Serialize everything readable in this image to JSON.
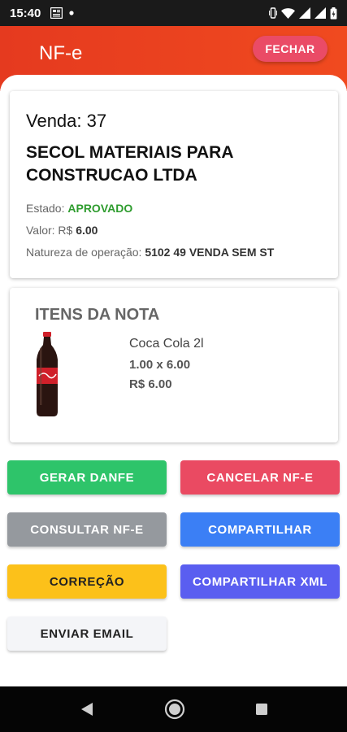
{
  "status_bar": {
    "time": "15:40"
  },
  "app_bar": {
    "title": "NF-e",
    "close_label": "FECHAR"
  },
  "sale": {
    "label": "Venda: 37",
    "company": "SECOL MATERIAIS PARA CONSTRUCAO LTDA",
    "state_label": "Estado:",
    "state_value": "APROVADO",
    "value_label": "Valor: R$",
    "value_value": "6.00",
    "nature_label": "Natureza de operação:",
    "nature_value": "5102 49 VENDA SEM ST"
  },
  "items": {
    "title": "ITENS DA NOTA",
    "list": [
      {
        "name": "Coca Cola 2l",
        "qty": "1.00 x 6.00",
        "total": "R$ 6.00"
      }
    ]
  },
  "actions": {
    "gerar_danfe": "GERAR DANFE",
    "cancelar": "CANCELAR NF-E",
    "consultar": "CONSULTAR NF-E",
    "compartilhar": "COMPARTILHAR",
    "correcao": "CORREÇÃO",
    "compartilhar_xml": "COMPARTILHAR XML",
    "enviar_email": "ENVIAR EMAIL"
  },
  "colors": {
    "app_bar": "#e53a1f",
    "close_button": "#ea4b66",
    "gerar_danfe": "#2ec46a",
    "cancelar": "#ea4a62",
    "consultar": "#95999e",
    "compartilhar": "#3b7ff5",
    "correcao": "#fcc11a",
    "compartilhar_xml": "#5a5ef0",
    "enviar_email": "#f4f5f8",
    "approved": "#2e9c2e"
  },
  "icons": [
    "notification-news-icon",
    "dot-icon",
    "vibrate-icon",
    "wifi-icon",
    "signal-icon",
    "signal-icon",
    "battery-icon",
    "back-icon",
    "home-icon",
    "recents-icon"
  ]
}
